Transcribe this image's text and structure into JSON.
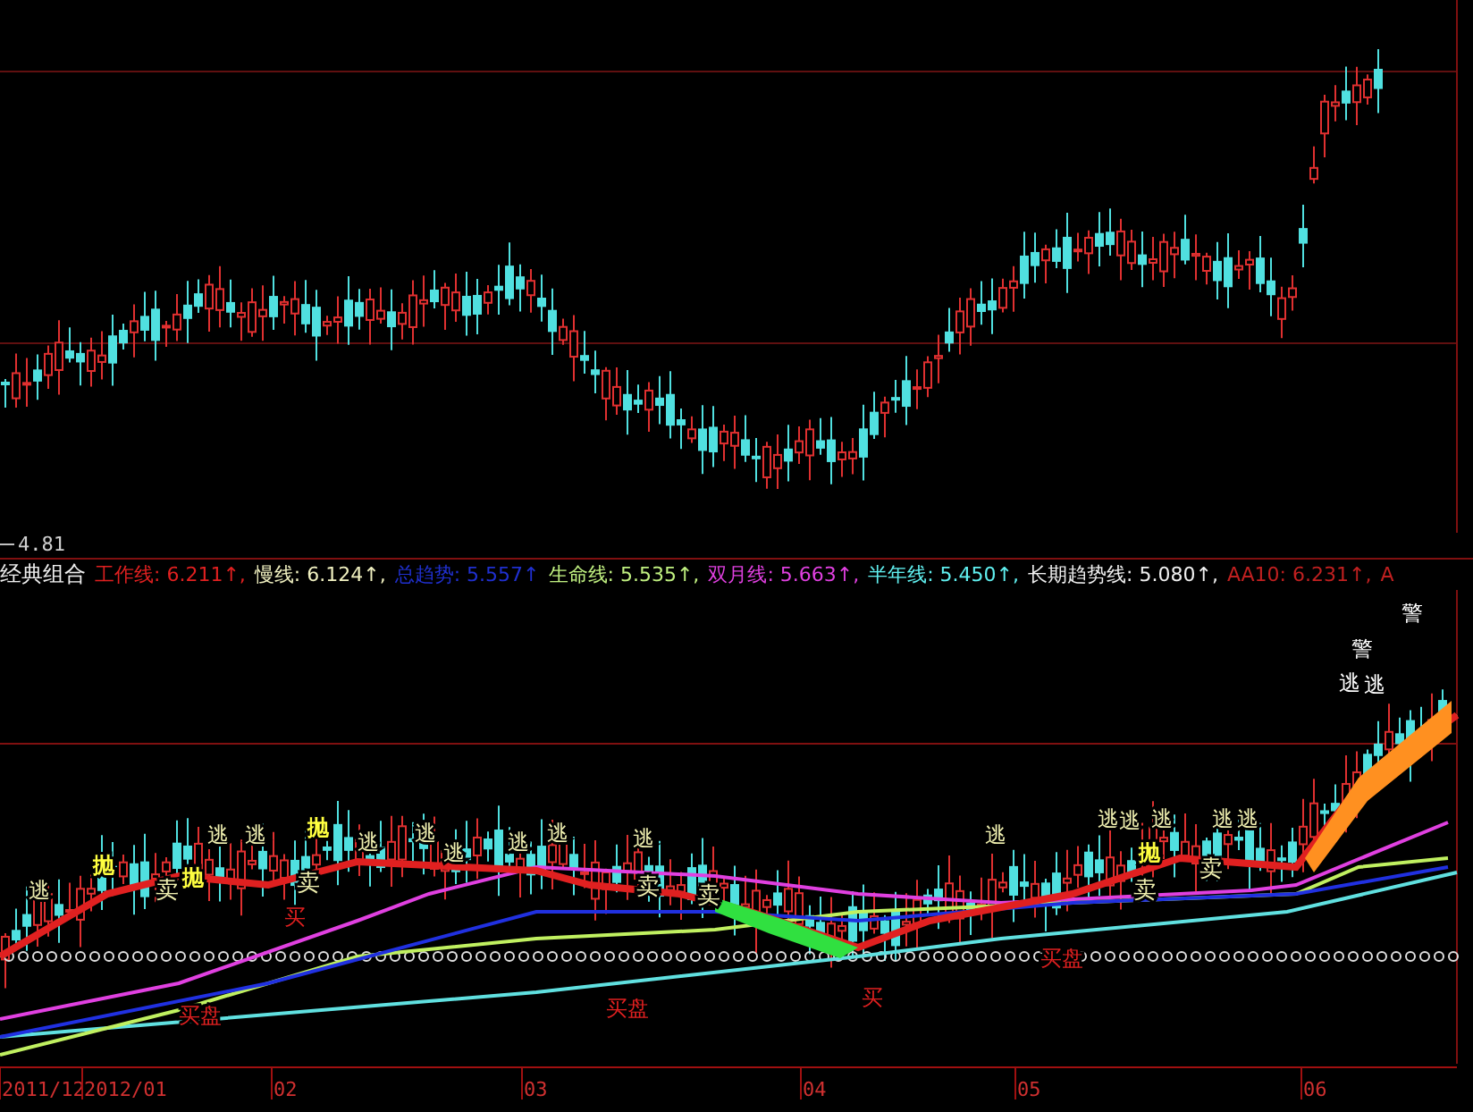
{
  "price_label": "4.81",
  "legend": {
    "title": "经典组合",
    "items": [
      {
        "text": "工作线: 6.211↑,",
        "color": "#e02020"
      },
      {
        "text": "慢线: 6.124↑,",
        "color": "#f0f0c0"
      },
      {
        "text": "总趋势: 5.557↑",
        "color": "#2030d0"
      },
      {
        "text": "生命线: 5.535↑,",
        "color": "#c0f080"
      },
      {
        "text": "双月线: 5.663↑,",
        "color": "#e040e0"
      },
      {
        "text": "半年线: 5.450↑,",
        "color": "#60f0f0"
      },
      {
        "text": "长期趋势线: 5.080↑,",
        "color": "#f0f0f0"
      },
      {
        "text": "AA10: 6.231↑,",
        "color": "#c02020"
      },
      {
        "text": "A",
        "color": "#c02020"
      }
    ]
  },
  "signals": [
    {
      "kind": "flee",
      "text": "逃"
    },
    {
      "kind": "flee",
      "text": "逃"
    },
    {
      "kind": "flee",
      "text": "逃"
    },
    {
      "kind": "flee",
      "text": "逃"
    },
    {
      "kind": "flee",
      "text": "逃"
    },
    {
      "kind": "flee",
      "text": "逃"
    },
    {
      "kind": "flee",
      "text": "逃"
    },
    {
      "kind": "flee",
      "text": "逃"
    },
    {
      "kind": "flee",
      "text": "逃"
    },
    {
      "kind": "flee",
      "text": "逃"
    },
    {
      "kind": "flee",
      "text": "逃"
    },
    {
      "kind": "flee",
      "text": "逃"
    },
    {
      "kind": "flee",
      "text": "逃"
    },
    {
      "kind": "flee",
      "text": "逃"
    },
    {
      "kind": "flee",
      "text": "逃"
    },
    {
      "kind": "dump",
      "text": "抛"
    },
    {
      "kind": "dump",
      "text": "抛"
    },
    {
      "kind": "dump",
      "text": "抛"
    },
    {
      "kind": "dump",
      "text": "抛"
    },
    {
      "kind": "sell",
      "text": "卖"
    },
    {
      "kind": "sell",
      "text": "卖"
    },
    {
      "kind": "sell",
      "text": "卖"
    },
    {
      "kind": "sell",
      "text": "卖"
    },
    {
      "kind": "sell",
      "text": "卖"
    },
    {
      "kind": "sell",
      "text": "卖"
    },
    {
      "kind": "buy",
      "text": "买"
    },
    {
      "kind": "buy",
      "text": "买"
    },
    {
      "kind": "buy_plate",
      "text": "买盘"
    },
    {
      "kind": "buy_plate",
      "text": "买盘"
    },
    {
      "kind": "buy_plate",
      "text": "买盘"
    },
    {
      "kind": "warn",
      "text": "警"
    },
    {
      "kind": "warn",
      "text": "警"
    },
    {
      "kind": "flee_white",
      "text": "逃"
    },
    {
      "kind": "flee_white",
      "text": "逃"
    }
  ],
  "x_axis": [
    "2011/12",
    "2012/01",
    "02",
    "03",
    "04",
    "05",
    "06"
  ]
}
